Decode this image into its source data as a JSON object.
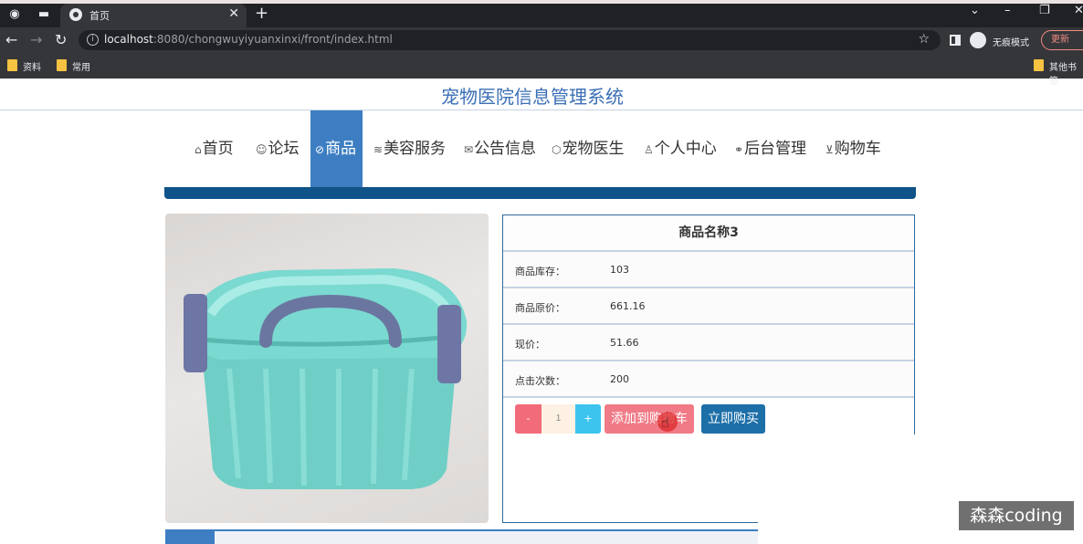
{
  "browser": {
    "tab_title": "首页",
    "url_host": "localhost",
    "url_rest": ":8080/chongwuyiyuanxinxi/front/index.html",
    "incognito_label": "无痕模式",
    "update_label": "更新",
    "bookmarks": [
      "资料",
      "常用"
    ],
    "other_bookmarks": "其他书签"
  },
  "site": {
    "title": "宠物医院信息管理系统"
  },
  "menu": {
    "items": [
      {
        "icon": "⌂",
        "label": "首页"
      },
      {
        "icon": "☺",
        "label": "论坛"
      },
      {
        "icon": "⊘",
        "label": "商品",
        "active": true
      },
      {
        "icon": "≋",
        "label": "美容服务"
      },
      {
        "icon": "✉",
        "label": "公告信息"
      },
      {
        "icon": "⬡",
        "label": "宠物医生"
      },
      {
        "icon": "♙",
        "label": "个人中心"
      },
      {
        "icon": "⚭",
        "label": "后台管理"
      },
      {
        "icon": "⊻",
        "label": "购物车"
      }
    ]
  },
  "product": {
    "name": "商品名称3",
    "fields": [
      {
        "label": "商品库存：",
        "value": "103"
      },
      {
        "label": "商品原价：",
        "value": "661.16"
      },
      {
        "label": "现价：",
        "value": "51.66"
      },
      {
        "label": "点击次数：",
        "value": "200"
      }
    ],
    "quantity": "1",
    "minus_label": "-",
    "plus_label": "+",
    "add_to_cart_label": "添加到购物车",
    "buy_now_label": "立即购买"
  },
  "watermark": "森森coding",
  "colors": {
    "accent": "#3d7ec2",
    "menu_bar": "#0f5388",
    "cart_button": "#f07a86",
    "buy_button": "#1d6fa8",
    "title": "#3a6fb5"
  }
}
